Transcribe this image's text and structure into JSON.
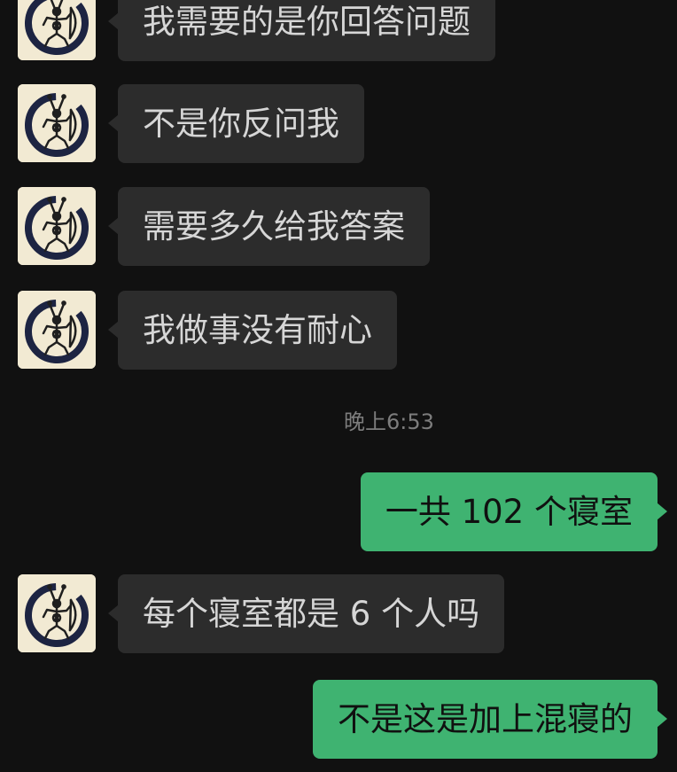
{
  "chat": {
    "messages": [
      {
        "direction": "incoming",
        "text": "我需要的是你回答问题",
        "avatar_icon": "ant-figure-avatar-icon"
      },
      {
        "direction": "incoming",
        "text": "不是你反问我",
        "avatar_icon": "ant-figure-avatar-icon"
      },
      {
        "direction": "incoming",
        "text": "需要多久给我答案",
        "avatar_icon": "ant-figure-avatar-icon"
      },
      {
        "direction": "incoming",
        "text": "我做事没有耐心",
        "avatar_icon": "ant-figure-avatar-icon"
      },
      {
        "direction": "outgoing",
        "text": "一共 102 个寝室"
      },
      {
        "direction": "incoming",
        "text": "每个寝室都是 6 个人吗",
        "avatar_icon": "ant-figure-avatar-icon"
      },
      {
        "direction": "outgoing",
        "text": "不是这是加上混寝的"
      }
    ],
    "timestamp": "晚上6:53"
  },
  "colors": {
    "background": "#111111",
    "incoming_bubble": "#2c2c2c",
    "incoming_text": "#d6d6d6",
    "outgoing_bubble": "#3fb371",
    "outgoing_text": "#101010",
    "timestamp": "#7d7d7d",
    "avatar_background": "#f2ead3",
    "avatar_ring": "#1d2442"
  }
}
